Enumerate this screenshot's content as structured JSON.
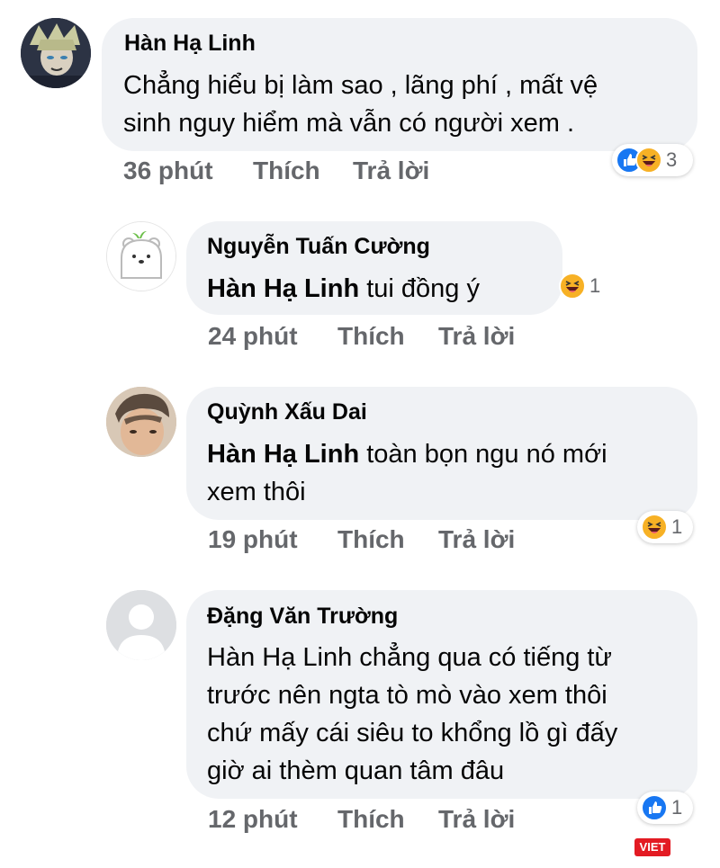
{
  "comments": [
    {
      "author": "Hàn Hạ Linh",
      "text_line1": "Chẳng hiểu bị làm sao , lãng phí , mất vệ",
      "text_line2": "sinh nguy hiểm mà vẫn có người xem .",
      "time": "36 phút",
      "like": "Thích",
      "reply": "Trả lời",
      "reaction_count": "3",
      "reactions": [
        "like-icon",
        "haha-icon"
      ]
    },
    {
      "author": "Nguyễn Tuấn Cường",
      "mention": "Hàn Hạ Linh",
      "text": " tui đồng ý",
      "time": "24 phút",
      "like": "Thích",
      "reply": "Trả lời",
      "reaction_count": "1",
      "reactions": [
        "haha-icon"
      ]
    },
    {
      "author": "Quỳnh Xấu Dai",
      "mention": "Hàn Hạ Linh",
      "text_line1": " toàn bọn ngu nó mới",
      "text_line2": "xem thôi",
      "time": "19 phút",
      "like": "Thích",
      "reply": "Trả lời",
      "reaction_count": "1",
      "reactions": [
        "haha-icon"
      ]
    },
    {
      "author": "Đặng Văn Trường",
      "text_line1": "Hàn Hạ Linh chẳng qua có tiếng từ",
      "text_line2": "trước nên ngta tò mò vào xem thôi",
      "text_line3": "chứ mấy cái siêu to khổng lồ gì đấy",
      "text_line4": "giờ ai thèm quan tâm đâu",
      "time": "12 phút",
      "like": "Thích",
      "reply": "Trả lời",
      "reaction_count": "1",
      "reactions": [
        "like-icon"
      ]
    }
  ],
  "watermark": "VIET",
  "colors": {
    "bubble": "#f0f2f5",
    "meta": "#65676b",
    "like": "#1877f2",
    "haha": "#f7b125"
  }
}
